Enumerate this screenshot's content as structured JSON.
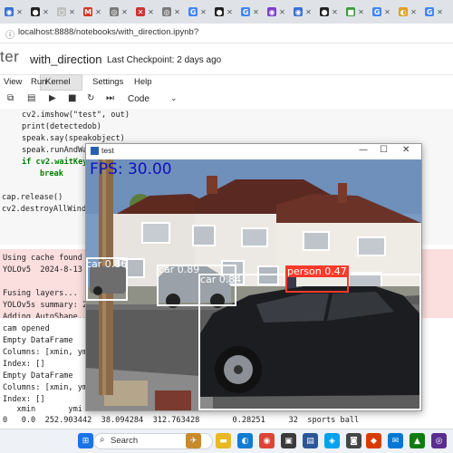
{
  "browser": {
    "tabs": [
      {
        "icon": "globe-icon",
        "color": "#3b6fd1",
        "glyph": "◉"
      },
      {
        "icon": "github-icon",
        "color": "#222222",
        "glyph": "●"
      },
      {
        "icon": "app-icon",
        "color": "#c0c0c0",
        "glyph": "○"
      },
      {
        "icon": "gmail-icon",
        "color": "#d93025",
        "glyph": "M"
      },
      {
        "icon": "app-icon",
        "color": "#7a7a7a",
        "glyph": "◎"
      },
      {
        "icon": "close-app-icon",
        "color": "#c33",
        "glyph": "✕"
      },
      {
        "icon": "app-icon",
        "color": "#7a7a7a",
        "glyph": "◎"
      },
      {
        "icon": "google-icon",
        "color": "#4285f4",
        "glyph": "G"
      },
      {
        "icon": "github-icon",
        "color": "#222222",
        "glyph": "●"
      },
      {
        "icon": "google-icon",
        "color": "#4285f4",
        "glyph": "G"
      },
      {
        "icon": "app-icon",
        "color": "#7b3fc6",
        "glyph": "◉"
      },
      {
        "icon": "app-icon",
        "color": "#3b6fd1",
        "glyph": "◉"
      },
      {
        "icon": "github-icon",
        "color": "#222222",
        "glyph": "●"
      },
      {
        "icon": "app-icon",
        "color": "#3a9d3a",
        "glyph": "■"
      },
      {
        "icon": "google-icon",
        "color": "#4285f4",
        "glyph": "G"
      },
      {
        "icon": "app-icon",
        "color": "#e0a020",
        "glyph": "◐"
      },
      {
        "icon": "google-icon",
        "color": "#4285f4",
        "glyph": "G"
      }
    ],
    "url": "localhost:8888/notebooks/with_direction.ipynb?"
  },
  "jupyter": {
    "logo_text": "ter",
    "notebook_name": "with_direction",
    "checkpoint": "Last Checkpoint: 2 days ago",
    "menu": [
      "View",
      "Run",
      "Kernel",
      "Settings",
      "Help"
    ],
    "cell_type": "Code"
  },
  "code_lines": [
    "cv2.imshow(\"test\", out)",
    "print(detectedob)",
    "speak.say(speakobject)",
    "speak.runAndWa",
    "if cv2.waitKey",
    "break",
    "cap.release()",
    "cv2.destroyAllWind"
  ],
  "output_stderr": [
    "Using cache found",
    "YOLOv5  2024-8-13",
    "Fusing layers...",
    "YOLOv5s summary: 2",
    "Adding AutoShape..."
  ],
  "output_stdout": [
    "cam opened",
    "Empty DataFrame",
    "Columns: [xmin, ym",
    "Index: []",
    "Empty DataFrame",
    "Columns: [xmin, ym",
    "Index: []",
    "   xmin       ymi",
    "0   0.0  252.903442  38.094284  312.763428       0.28251     32  sports ball"
  ],
  "cv_window": {
    "title": "test",
    "fps_label": "FPS: 30.00",
    "detections": [
      {
        "label": "car 0.86"
      },
      {
        "label": "car 0.89"
      },
      {
        "label": "car 0.84"
      },
      {
        "label": "person 0.47"
      }
    ]
  },
  "taskbar": {
    "search_label": "Search",
    "icons": [
      {
        "name": "windows-start-icon",
        "color": "#1a73e8",
        "glyph": "⊞"
      },
      {
        "name": "widget-icon",
        "color": "#c98a2a",
        "glyph": "✈"
      },
      {
        "name": "file-explorer-icon",
        "color": "#e8b923",
        "glyph": "▬"
      },
      {
        "name": "edge-icon",
        "color": "#0f7bd1",
        "glyph": "◐"
      },
      {
        "name": "chrome-icon",
        "color": "#db4437",
        "glyph": "◉"
      },
      {
        "name": "store-icon",
        "color": "#3a3a3a",
        "glyph": "▣"
      },
      {
        "name": "app-icon",
        "color": "#2b5797",
        "glyph": "▤"
      },
      {
        "name": "app-icon",
        "color": "#00a2ed",
        "glyph": "◈"
      },
      {
        "name": "camera-icon",
        "color": "#444444",
        "glyph": "◙"
      },
      {
        "name": "app-icon",
        "color": "#d83b01",
        "glyph": "◆"
      },
      {
        "name": "mail-icon",
        "color": "#0078d4",
        "glyph": "✉"
      },
      {
        "name": "app-icon",
        "color": "#107c10",
        "glyph": "▲"
      },
      {
        "name": "app-icon",
        "color": "#5c2d91",
        "glyph": "◎"
      }
    ]
  }
}
